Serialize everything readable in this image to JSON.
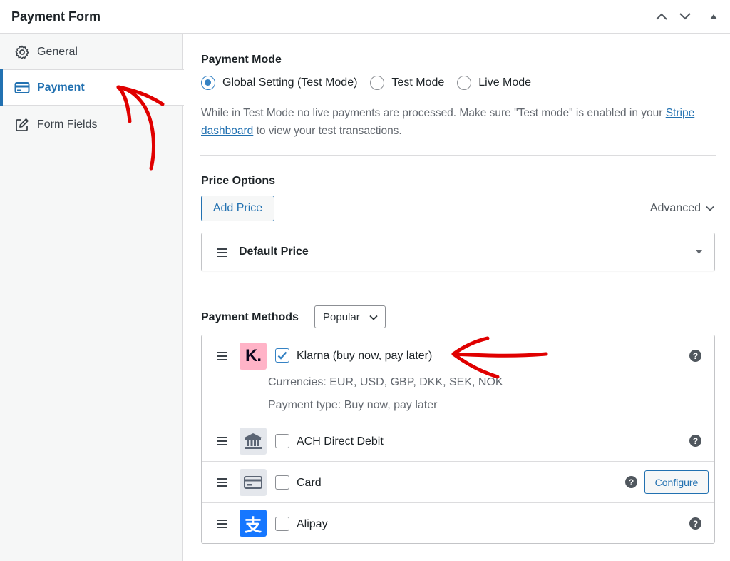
{
  "header": {
    "title": "Payment Form"
  },
  "sidebar": {
    "items": [
      {
        "label": "General",
        "icon": "gear-icon"
      },
      {
        "label": "Payment",
        "icon": "credit-card-icon",
        "active": true
      },
      {
        "label": "Form Fields",
        "icon": "edit-icon"
      }
    ]
  },
  "payment_mode": {
    "title": "Payment Mode",
    "options": [
      {
        "label": "Global Setting (Test Mode)",
        "checked": true
      },
      {
        "label": "Test Mode",
        "checked": false
      },
      {
        "label": "Live Mode",
        "checked": false
      }
    ],
    "description_before": "While in Test Mode no live payments are processed. Make sure \"Test mode\" is enabled in your ",
    "description_link": "Stripe dashboard",
    "description_after": " to view your test transactions."
  },
  "price_options": {
    "title": "Price Options",
    "add_button": "Add Price",
    "advanced_label": "Advanced",
    "default_price_label": "Default Price"
  },
  "payment_methods": {
    "title": "Payment Methods",
    "filter_value": "Popular",
    "items": [
      {
        "name": "Klarna (buy now, pay later)",
        "checked": true,
        "currencies": "Currencies: EUR, USD, GBP, DKK, SEK, NOK",
        "payment_type": "Payment type: Buy now, pay later",
        "logo_text": "K."
      },
      {
        "name": "ACH Direct Debit",
        "checked": false
      },
      {
        "name": "Card",
        "checked": false,
        "configure_label": "Configure"
      },
      {
        "name": "Alipay",
        "checked": false,
        "logo_text": "支"
      }
    ]
  },
  "colors": {
    "accent": "#2271b1",
    "annotation_arrow": "#e00000",
    "klarna_pink": "#ffb3c7",
    "alipay_blue": "#1677ff"
  }
}
